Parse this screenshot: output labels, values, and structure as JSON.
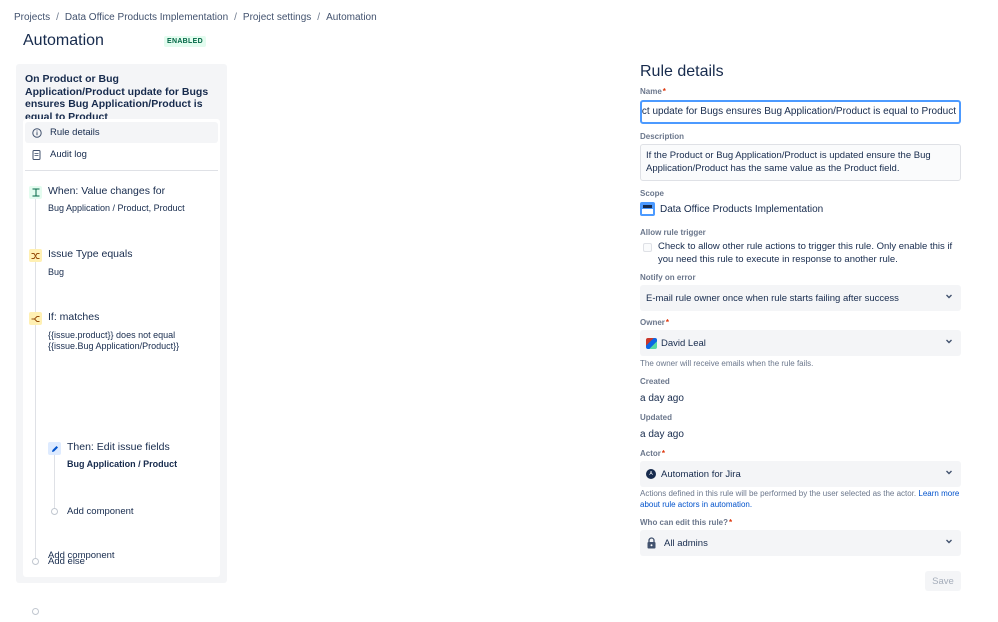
{
  "breadcrumb": {
    "items": [
      "Projects",
      "Data Office Products Implementation",
      "Project settings",
      "Automation"
    ],
    "separator": "/"
  },
  "header": {
    "title": "Automation",
    "status": "ENABLED"
  },
  "rule": {
    "name": "On Product or Bug Application/Product update for Bugs ensures Bug Application/Product is equal to Product",
    "nav": {
      "details": "Rule details",
      "audit": "Audit log"
    },
    "trigger": {
      "title": "When: Value changes for",
      "detail": "Bug Application / Product, Product"
    },
    "condition": {
      "title": "Issue Type equals",
      "detail": "Bug"
    },
    "if_block": {
      "title": "If: matches",
      "detail_line1": "{{issue.product}} does not equal",
      "detail_line2": "{{issue.Bug Application/Product}}"
    },
    "action": {
      "title": "Then: Edit issue fields",
      "detail": "Bug Application / Product"
    },
    "add_component_inner": "Add component",
    "add_else": "Add else",
    "add_component_outer": "Add component"
  },
  "form": {
    "title": "Rule details",
    "name_label": "Name",
    "name_value": "On Product or Bug Application/Product update for Bugs ensures Bug Application/Product is equal to Product",
    "description_label": "Description",
    "description_value": "If the Product or Bug Application/Product is updated ensure the Bug Application/Product has the same value as the Product field.",
    "scope_label": "Scope",
    "scope_value": "Data Office Products Implementation",
    "allow_trigger_label": "Allow rule trigger",
    "allow_trigger_text": "Check to allow other rule actions to trigger this rule. Only enable this if you need this rule to execute in response to another rule.",
    "notify_label": "Notify on error",
    "notify_value": "E-mail rule owner once when rule starts failing after success",
    "owner_label": "Owner",
    "owner_value": "David Leal",
    "owner_helper": "The owner will receive emails when the rule fails.",
    "created_label": "Created",
    "created_value": "a day ago",
    "updated_label": "Updated",
    "updated_value": "a day ago",
    "actor_label": "Actor",
    "actor_value": "Automation for Jira",
    "actor_helper_text": "Actions defined in this rule will be performed by the user selected as the actor.",
    "actor_helper_link": "Learn more about rule actors in automation.",
    "editors_label": "Who can edit this rule?",
    "editors_value": "All admins",
    "required_mark": "*",
    "save_label": "Save"
  },
  "colors": {
    "accent": "#0052cc",
    "focus": "#4c9aff",
    "enabled_bg": "#e3fcef",
    "enabled_fg": "#006644",
    "trigger_icon": "#e3fcef",
    "condition_icon": "#fff0b3",
    "action_icon": "#deebff"
  }
}
